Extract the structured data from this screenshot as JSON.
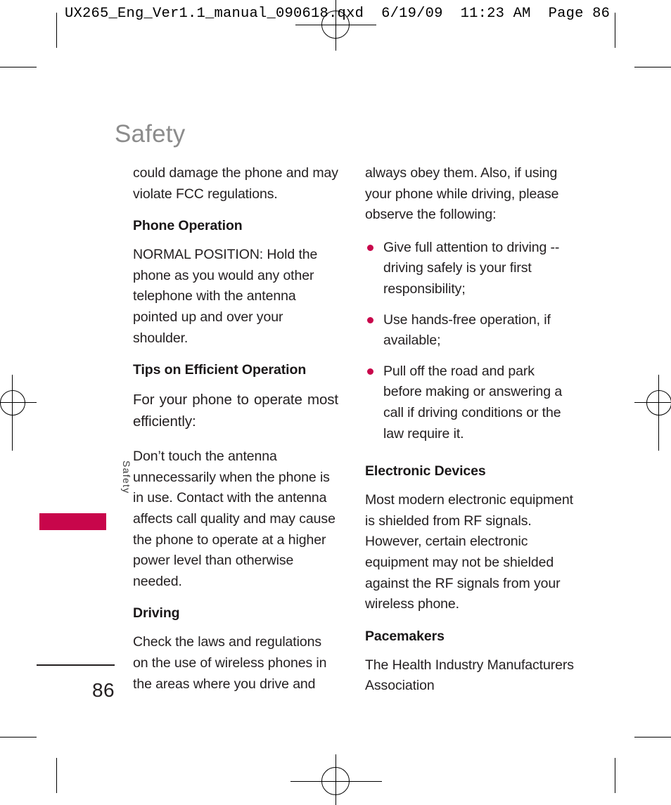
{
  "prepress": {
    "header_line": "UX265_Eng_Ver1.1_manual_090618.qxd  6/19/09  11:23 AM  Page 86"
  },
  "page": {
    "title": "Safety",
    "folio": "86",
    "side_tab_label": "Safety",
    "accent_color": "#c8064b",
    "title_color": "#8c8c8c"
  },
  "columns": {
    "left": {
      "blocks": [
        {
          "kind": "paragraph",
          "text": "could damage the phone and may violate FCC regulations."
        },
        {
          "kind": "heading",
          "text": "Phone Operation"
        },
        {
          "kind": "paragraph",
          "text": "NORMAL POSITION: Hold the phone as you would any other telephone with the antenna pointed up and over your shoulder."
        },
        {
          "kind": "heading",
          "text": "Tips on Efficient Operation"
        },
        {
          "kind": "paragraph-justified",
          "text": "For your phone to operate most efficiently:"
        },
        {
          "kind": "paragraph",
          "text": "Don’t touch the antenna unnecessarily when the phone is in use. Contact with the antenna affects call quality and may cause the phone to operate at a higher power level than otherwise needed."
        },
        {
          "kind": "heading",
          "text": "Driving"
        },
        {
          "kind": "paragraph",
          "text": "Check the laws and regulations on the use of wireless phones in the areas where you drive and"
        }
      ]
    },
    "right": {
      "blocks": [
        {
          "kind": "paragraph",
          "text": "always obey them. Also, if using your phone while driving, please observe the following:"
        },
        {
          "kind": "bullets",
          "items": [
            "Give full attention to driving -- driving safely is your first responsibility;",
            "Use hands-free operation, if available;",
            "Pull off the road and park before making or answering a call if driving conditions or the law require it."
          ]
        },
        {
          "kind": "heading",
          "text": "Electronic Devices"
        },
        {
          "kind": "paragraph",
          "text": "Most modern electronic equipment is shielded from RF signals. However, certain electronic equipment may not be shielded against the RF signals from your wireless phone."
        },
        {
          "kind": "heading",
          "text": "Pacemakers"
        },
        {
          "kind": "paragraph",
          "text": "The Health Industry Manufacturers Association"
        }
      ]
    }
  }
}
